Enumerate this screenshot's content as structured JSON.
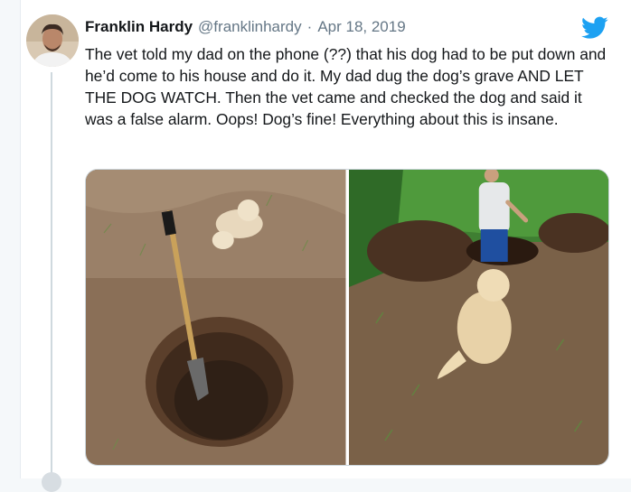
{
  "tweet": {
    "author_name": "Franklin Hardy",
    "handle": "@franklinhardy",
    "separator": "·",
    "date": "Apr 18, 2019",
    "text": "The vet told my dad on the phone (??) that his dog had to be put down and he’d come to his house and do it. My dad dug the dog’s grave AND LET THE DOG WATCH. Then the vet came and checked the dog and said it was a false alarm. Oops! Dog’s fine! Everything about this is insane."
  },
  "icons": {
    "brand": "twitter-bird-icon"
  },
  "colors": {
    "twitter_blue": "#1da1f2",
    "name_text": "#14171a",
    "secondary_text": "#657786"
  }
}
